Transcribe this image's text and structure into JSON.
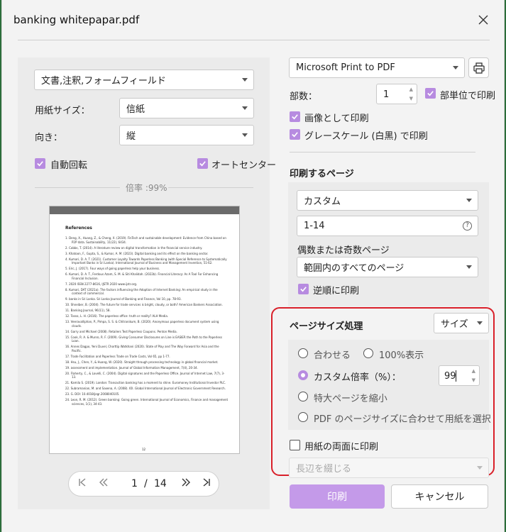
{
  "dialog": {
    "title": "banking whitepapar.pdf"
  },
  "left": {
    "content_select": "文書,注釈,フォームフィールド",
    "paper_size_label": "用紙サイズ：",
    "paper_size": "信紙",
    "orientation_label": "向き：",
    "orientation": "縦",
    "auto_rotate": "自動回転",
    "auto_center": "オートセンター",
    "scale_text": "倍率 :99%",
    "preview": {
      "heading": "References",
      "page_number": "12",
      "refs": [
        "Deng, X., Huang, Z., & Cheng, X. (2019). FinTech and sustainable development: Evidence from China based on P2P data. Sustainability, 11(22), 6434.",
        "Cobbs, T. (2014). A literature review on digital transformation in the financial service industry.",
        "Khatoon, F., Gupta, S., & Kumar, A. M. (2023). Digital banking and its effect on the banking sector.",
        "Kumari, D. A. T. (2021). Customer Loyalty Towards Paperless Banking (with Special Reference to Systematically Important Banks in Sri Lanka). International Journal of Business and Management Invention, 51-62.",
        "Eric, J. (2017). Four ways of going paperless help your business.",
        "Kumari, D. A. T., Ferdous Azam, S. M. & Siti Khalidah. (2022b). Financial Literacy: As A Tool For Enhancing Financial Inclusion.",
        "2020 ISSN 2277-8616, IJSTR 2020 www.ijstr.org.",
        "Kumari, DAT (2021a). The factors influencing the Adoption of Internet Banking: An empirical study in the context of commercial.",
        "banks in Sri Lanka. Sri Lanka Journal of Banking and Finance, Vol 10, pp. 78-93.",
        "Shneiber, B. (2004). The future for trade services is bright, cloudy, or both? American Bankers Association.",
        "Banking Journal, 96(11), 58.",
        "Tosso, L. H. (2016). The paperless office: truth or reality? ALH Media.",
        "Veeravalliphan, P., Pimpa, S. S. & Chitranikum, B. (2020). Anonymous paperless document system using clouds.",
        "Garry and Michael (2008). Retailers Test Paperless Coupons. Penton Media.",
        "Cook, R. A. & Munro, R. F. (2009). Giving Consumer Disclosures on Line is EASIER the Path to the Paperless Loan.",
        "Annes Dagpo, Yeni Duvel, Chorttip Watkhani (2020). State of Play and The Way Forward for Asia and the Pacific.",
        "Trade Facilitation and Paperless Trade on Trade Costs, Vol 65, pp 1-77.",
        "Hsu, J., Chen, Y., & Huang, W. (2020). Straight through processing technology in global financial market.",
        "assessment and implementation. Journal of Global Information Management, 7(4), 20-34.",
        "Flaherty, C., & Lovelli, C. (2004). Digital signatures and the Paperless Office. Journal of Internet Law, 7(7), 3-13.",
        "Kamila S. (2019). London: Transaction banking has a moment to shine. Euromoney Institutional Investor PLC.",
        "Subramanian, M. and Saxena, A. (2008). IOI. Global International Journal of Electronic Government Research.",
        "G. DOI: 10.4018/jegr.2008040105.",
        "Leon, R. M. (2012). Green banking: Going green. International Journal of Economics, Finance and management sciences, 1(1), 34-43."
      ]
    },
    "pager": {
      "current": "1",
      "separator": "/",
      "total": "14"
    }
  },
  "right": {
    "printer": "Microsoft Print to PDF",
    "copies_label": "部数：",
    "copies": "1",
    "collate": "部単位で印刷",
    "print_as_image": "画像として印刷",
    "grayscale": "グレースケール (白黒) で印刷",
    "pages_heading": "印刷するページ",
    "range_mode": "カスタム",
    "range": "1-14",
    "odd_even_label": "偶数または奇数ページ",
    "odd_even": "範囲内のすべてのページ",
    "reverse": "逆順に印刷",
    "sizing_heading": "ページサイズ処理",
    "sizing_mode": "サイズ",
    "fit": "合わせる",
    "actual": "100%表示",
    "custom_scale": "カスタム倍率（%）：",
    "custom_value": "99",
    "shrink": "特大ページを縮小",
    "choose_paper": "PDF のページサイズに合わせて用紙を選択",
    "duplex": "用紙の両面に印刷",
    "binding": "長辺を綴じる",
    "print_btn": "印刷",
    "cancel_btn": "キャンセル"
  },
  "colors": {
    "accent": "#b78be0",
    "highlight": "#d9202a"
  }
}
